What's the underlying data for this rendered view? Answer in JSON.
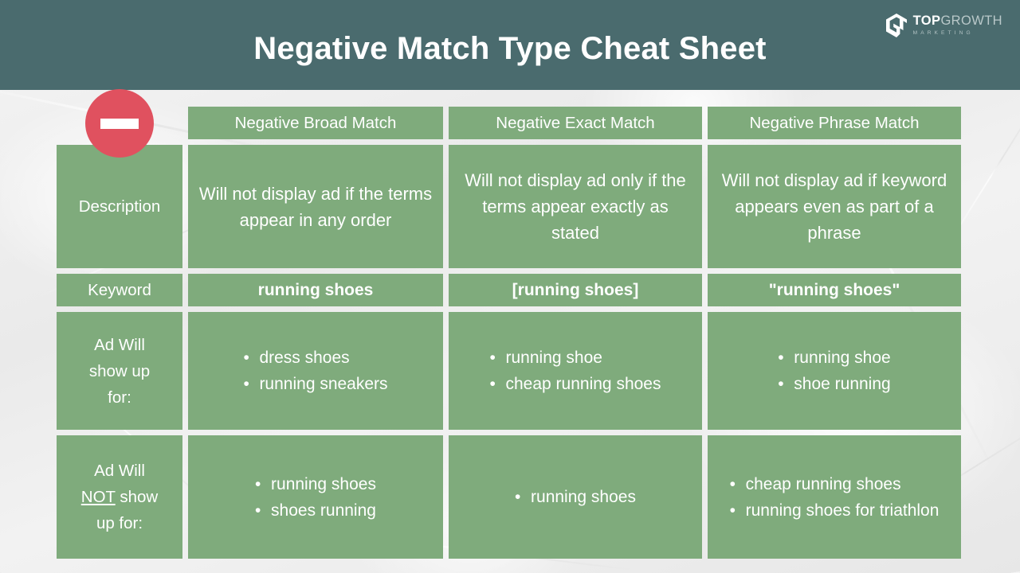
{
  "header": {
    "title": "Negative Match Type Cheat Sheet",
    "bg_color": "#4a6b6e",
    "logo": {
      "mark": "growth-arrow-icon",
      "name_primary": "TOP",
      "name_secondary": "GROWTH",
      "tagline": "MARKETING"
    }
  },
  "badge": {
    "icon": "no-entry-icon",
    "color": "#e0515f"
  },
  "table": {
    "cell_color": "#7fab7c",
    "columns": [
      {
        "key": "label",
        "header": ""
      },
      {
        "key": "broad",
        "header": "Negative Broad Match"
      },
      {
        "key": "exact",
        "header": "Negative Exact Match"
      },
      {
        "key": "phrase",
        "header": "Negative Phrase Match"
      }
    ],
    "rows": [
      {
        "name": "description",
        "label": "Description",
        "broad": "Will not display ad if the terms appear in any order",
        "exact": "Will not display ad only if the terms appear exactly as stated",
        "phrase": "Will not display ad if keyword appears even as part of a phrase"
      },
      {
        "name": "keyword",
        "label": "Keyword",
        "broad": "running shoes",
        "exact": "[running shoes]",
        "phrase": "\"running shoes\""
      },
      {
        "name": "ad-will-show",
        "label_line1": "Ad Will",
        "label_line2": "show up",
        "label_line3": "for:",
        "broad": [
          "dress shoes",
          "running sneakers"
        ],
        "exact": [
          "running shoe",
          "cheap running shoes"
        ],
        "phrase": [
          "running shoe",
          "shoe running"
        ]
      },
      {
        "name": "ad-will-not-show",
        "label_line1": "Ad Will",
        "label_line2_pre": "",
        "label_line2_emph": "NOT",
        "label_line2_post": " show",
        "label_line3": "up for:",
        "broad": [
          "running shoes",
          "shoes running"
        ],
        "exact": [
          "running shoes"
        ],
        "phrase": [
          "cheap running shoes",
          "running shoes for triathlon"
        ]
      }
    ]
  }
}
